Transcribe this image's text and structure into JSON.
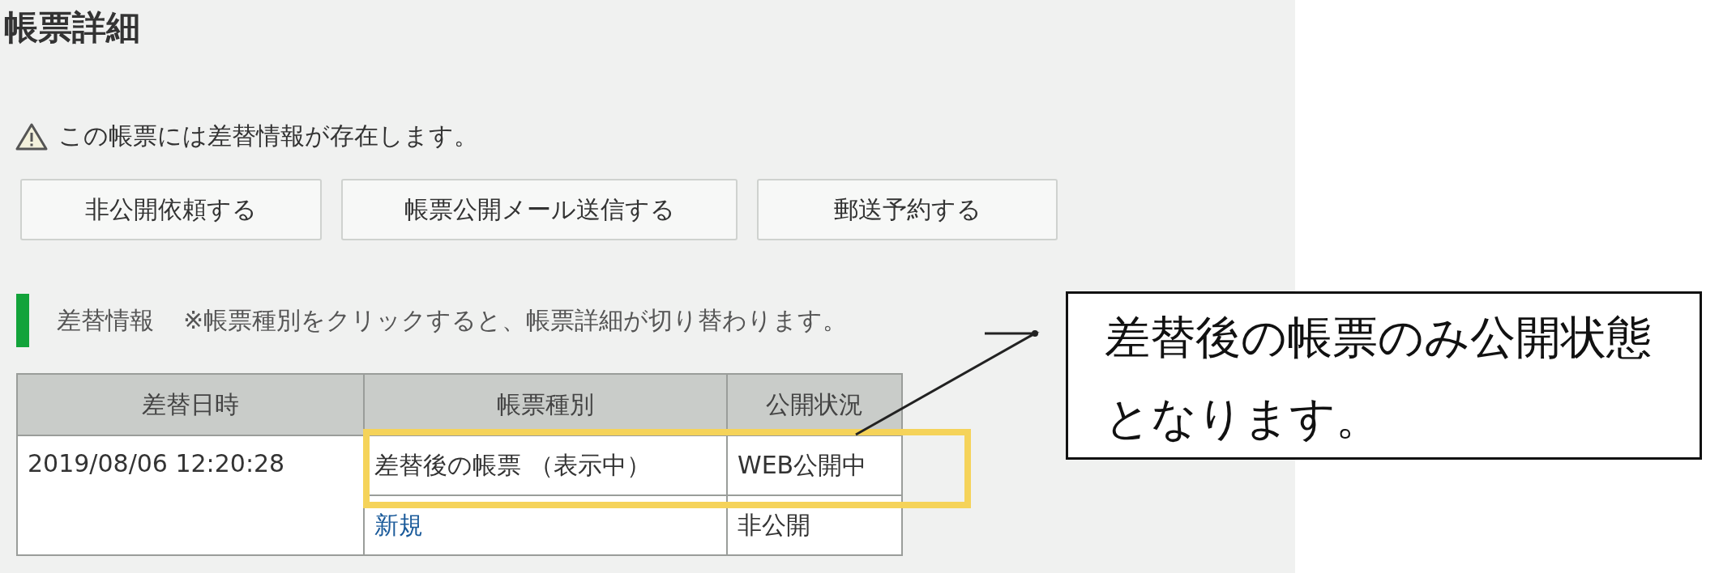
{
  "page": {
    "title": "帳票詳細"
  },
  "notice": {
    "text": "この帳票には差替情報が存在します。"
  },
  "buttons": [
    "非公開依頼する",
    "帳票公開メール送信する",
    "郵送予約する"
  ],
  "section": {
    "title": "差替情報",
    "note": "※帳票種別をクリックすると、帳票詳細が切り替わります。"
  },
  "table": {
    "columns": [
      "差替日時",
      "帳票種別",
      "公開状況"
    ],
    "groups": [
      {
        "date": "2019/08/06 12:20:28",
        "entries": [
          {
            "kind": "text",
            "type": "差替後の帳票 （表示中）",
            "status": "WEB公開中"
          },
          {
            "kind": "link",
            "type": "新規",
            "status": "非公開"
          }
        ]
      }
    ]
  },
  "callout": {
    "text": "差替後の帳票のみ公開状態となります。"
  }
}
